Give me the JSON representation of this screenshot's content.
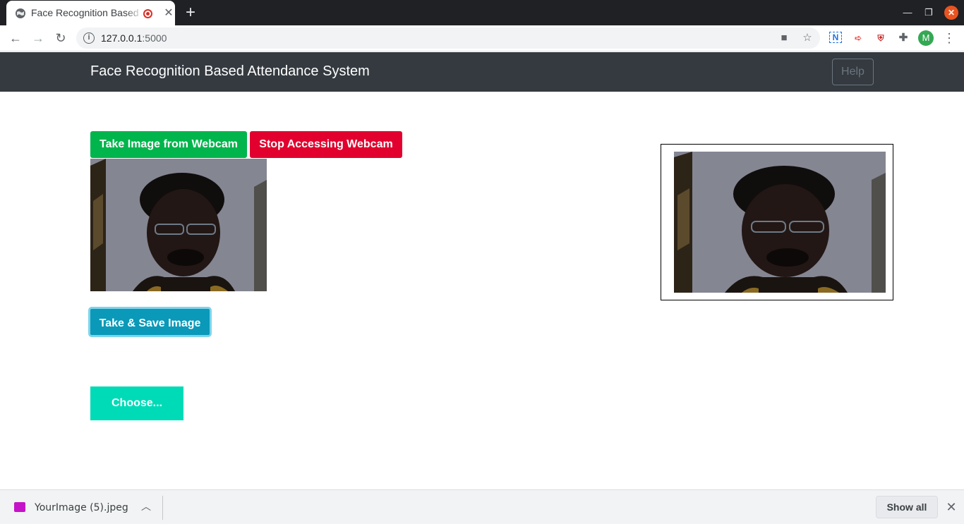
{
  "browser": {
    "tab_title": "Face Recognition Based Attendance System",
    "tab_close": "✕",
    "new_tab": "+",
    "url_host": "127.0.0.1",
    "url_port": ":5000",
    "icons": [
      "back-arrow-icon",
      "forward-arrow-icon",
      "reload-icon",
      "site-info-icon",
      "camera-icon",
      "star-icon",
      "extension-n-icon",
      "extension-arrow-icon",
      "extension-shield-icon",
      "puzzle-icon",
      "more-menu-icon"
    ],
    "profile_initial": "M",
    "recording_color": "#d93025"
  },
  "navbar": {
    "brand": "Face Recognition Based Attendance System",
    "help_label": "Help",
    "background": "#343a40"
  },
  "buttons": {
    "take_image_label": "Take Image from Webcam",
    "stop_webcam_label": "Stop Accessing Webcam",
    "save_label": "Take & Save Image",
    "choose_label": "Choose...",
    "colors": {
      "take_image": "#00b54c",
      "stop_webcam": "#e2002e",
      "save": "#0a99b8",
      "choose": "#00dbb7"
    }
  },
  "downloads": {
    "file_name": "YourImage (5).jpeg",
    "show_all_label": "Show all",
    "close": "✕"
  }
}
